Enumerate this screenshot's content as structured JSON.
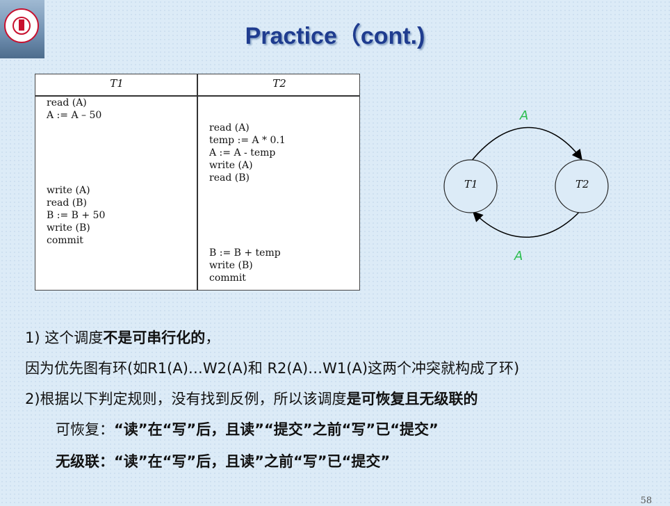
{
  "slide": {
    "title": "Practice（cont.)",
    "page_number": "58"
  },
  "colors": {
    "title": "#1f3c8f",
    "edge_label": "#2bbd4e",
    "node_fill": "#dcebf7"
  },
  "schedule": {
    "headers": [
      "T1",
      "T2"
    ],
    "t1_ops": [
      {
        "text": "read (A)",
        "row": 0
      },
      {
        "text": "A := A – 50",
        "row": 1
      },
      {
        "text": "write (A)",
        "row": 7
      },
      {
        "text": "read (B)",
        "row": 8
      },
      {
        "text": "B := B + 50",
        "row": 9
      },
      {
        "text": "write (B)",
        "row": 10
      },
      {
        "text": "commit",
        "row": 11
      }
    ],
    "t2_ops": [
      {
        "text": "read (A)",
        "row": 2
      },
      {
        "text": "temp := A * 0.1",
        "row": 3
      },
      {
        "text": "A := A - temp",
        "row": 4
      },
      {
        "text": "write (A)",
        "row": 5
      },
      {
        "text": "read (B)",
        "row": 6
      },
      {
        "text": "B := B + temp",
        "row": 12
      },
      {
        "text": "write (B)",
        "row": 13
      },
      {
        "text": "commit",
        "row": 14
      }
    ]
  },
  "precedence_graph": {
    "nodes": [
      "T1",
      "T2"
    ],
    "edges": [
      {
        "from": "T1",
        "to": "T2",
        "label": "A"
      },
      {
        "from": "T2",
        "to": "T1",
        "label": "A"
      }
    ]
  },
  "content": {
    "line1": {
      "a": "1) 这个调度",
      "b": "不是可串行化的",
      "c": "，"
    },
    "line2": "因为优先图有环(如R1(A)…W2(A)和 R2(A)…W1(A)这两个冲突就构成了环)",
    "line3": {
      "a": "2)根据以下判定规则，没有找到反例，所以该调度",
      "b": "是可恢复且无级联的"
    },
    "line4": {
      "a": "可恢复：",
      "b": "“读”在“写”后，且读”“提交”之前“写”已“提交”"
    },
    "line5": {
      "a": "无级联：",
      "b": "“读”在“写”后，且读”之前“写”已“提交”"
    }
  }
}
